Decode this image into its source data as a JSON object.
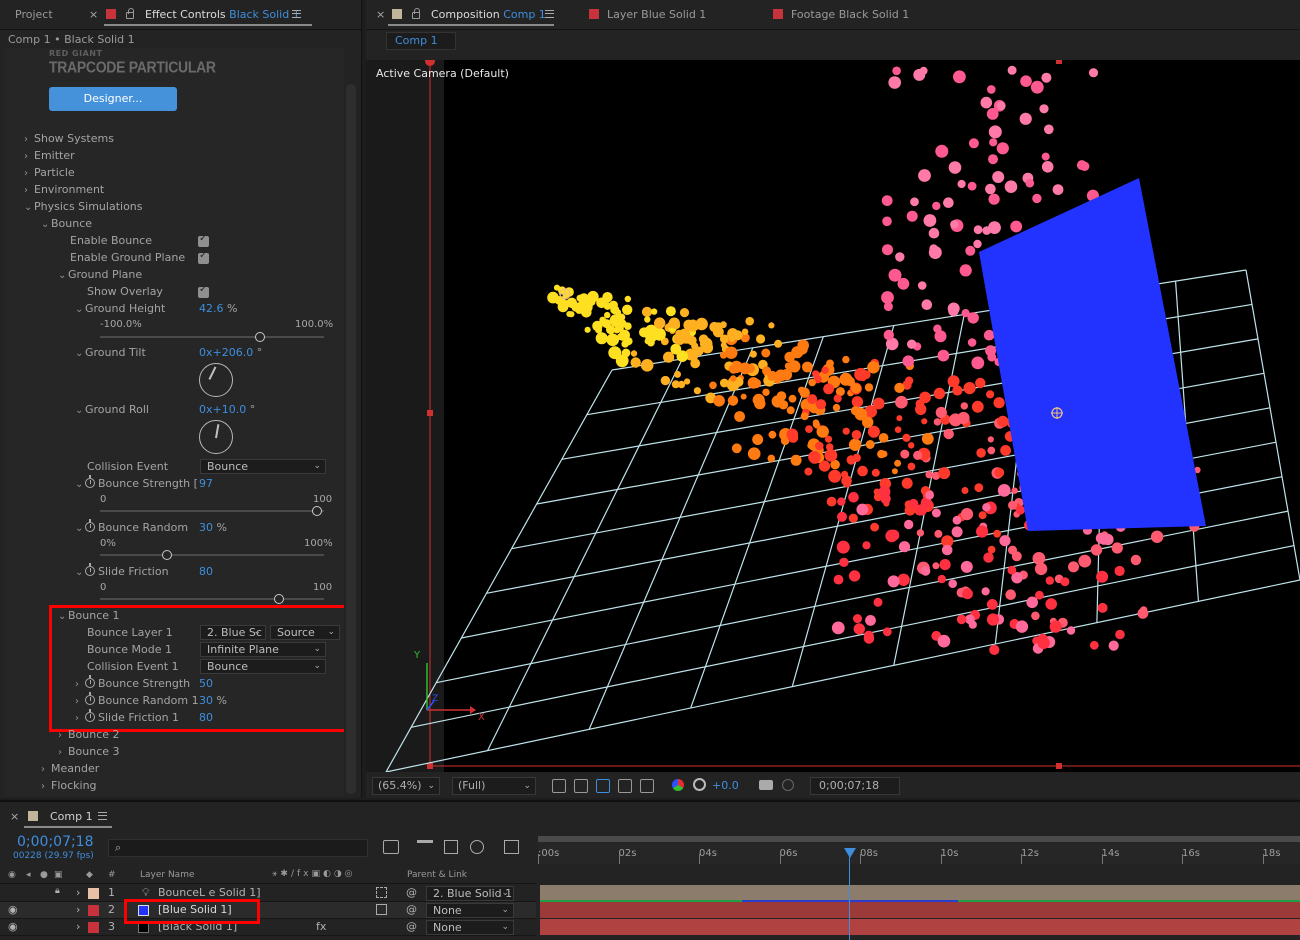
{
  "left_panel": {
    "tab_project": "Project",
    "tab_effect_controls_prefix": "Effect Controls",
    "tab_effect_controls_layer": "Black Solid 1",
    "breadcrumb": "Comp 1 • Black Solid 1",
    "logo_small": "RED GIANT",
    "logo_big": "TRAPCODE PARTICULAR",
    "designer_button": "Designer...",
    "groups": {
      "show_systems": "Show Systems",
      "emitter": "Emitter",
      "particle": "Particle",
      "environment": "Environment",
      "physics_simulations": "Physics Simulations",
      "bounce": "Bounce",
      "enable_bounce": "Enable Bounce",
      "enable_ground_plane": "Enable Ground Plane",
      "ground_plane": "Ground Plane",
      "show_overlay": "Show Overlay",
      "ground_height": "Ground Height",
      "ground_height_value": "42.6",
      "ground_height_unit": "%",
      "ground_height_min": "-100.0%",
      "ground_height_max": "100.0%",
      "ground_height_fraction": 0.713,
      "ground_tilt": "Ground Tilt",
      "ground_tilt_value": "0",
      "ground_tilt_value2": "x+206.0",
      "ground_tilt_deg": "°",
      "ground_roll": "Ground Roll",
      "ground_roll_value": "0",
      "ground_roll_value2": "x+10.0",
      "ground_roll_deg": "°",
      "collision_event": "Collision Event",
      "collision_event_value": "Bounce",
      "bounce_strength": "Bounce Strength [",
      "bounce_strength_value": "97",
      "bounce_strength_min": "0",
      "bounce_strength_max": "100",
      "bounce_strength_fraction": 0.97,
      "bounce_random": "Bounce Random",
      "bounce_random_value": "30",
      "bounce_random_unit": "%",
      "bounce_random_min": "0%",
      "bounce_random_max": "100%",
      "bounce_random_fraction": 0.3,
      "slide_friction": "Slide Friction",
      "slide_friction_value": "80",
      "slide_friction_min": "0",
      "slide_friction_max": "100",
      "slide_friction_fraction": 0.8
    },
    "bounce1": {
      "title": "Bounce 1",
      "bounce_layer": "Bounce Layer 1",
      "bounce_layer_value": "2. Blue Sc",
      "bounce_layer_source": "Source",
      "bounce_mode": "Bounce Mode 1",
      "bounce_mode_value": "Infinite Plane",
      "collision_event": "Collision Event 1",
      "collision_event_value": "Bounce",
      "bounce_strength": "Bounce Strength",
      "bounce_strength_value": "50",
      "bounce_random": "Bounce Random 1",
      "bounce_random_value": "30",
      "bounce_random_unit": "%",
      "slide_friction": "Slide Friction 1",
      "slide_friction_value": "80"
    },
    "bounce2": "Bounce 2",
    "bounce3": "Bounce 3",
    "meander": "Meander",
    "flocking": "Flocking"
  },
  "comp_panel": {
    "tab_composition_prefix": "Composition",
    "tab_composition_name": "Comp 1",
    "tab_layer": "Layer  Blue Solid 1",
    "tab_footage": "Footage  Black Solid 1",
    "subtab": "Comp 1",
    "active_camera": "Active Camera (Default)",
    "axis_y": "Y",
    "axis_x": "X",
    "axis_z": "Z",
    "zoom": "(65.4%)",
    "resolution": "(Full)",
    "exposure": "+0.0",
    "timecode": "0;00;07;18"
  },
  "timeline": {
    "tab": "Comp 1",
    "timecode": "0;00;07;18",
    "frame_info": "00228 (29.97 fps)",
    "search_placeholder": "",
    "col_layer_name": "Layer Name",
    "col_parent": "Parent & Link",
    "col_hash": "#",
    "ticks": [
      ":00s",
      "02s",
      "04s",
      "06s",
      "08s",
      "10s",
      "12s",
      "14s",
      "16s",
      "18s"
    ],
    "layers": [
      {
        "num": "1",
        "name": "BounceL  e Solid 1]",
        "parent": "2. Blue Solid 1"
      },
      {
        "num": "2",
        "name": "[Blue Solid 1]",
        "parent": "None"
      },
      {
        "num": "3",
        "name": "[Black Solid 1]",
        "parent": "None"
      }
    ]
  },
  "colors": {
    "accent": "#3e8edd",
    "highlight_red": "#ff0000",
    "blue_solid": "#2233ff",
    "designer_button": "#4592db"
  }
}
